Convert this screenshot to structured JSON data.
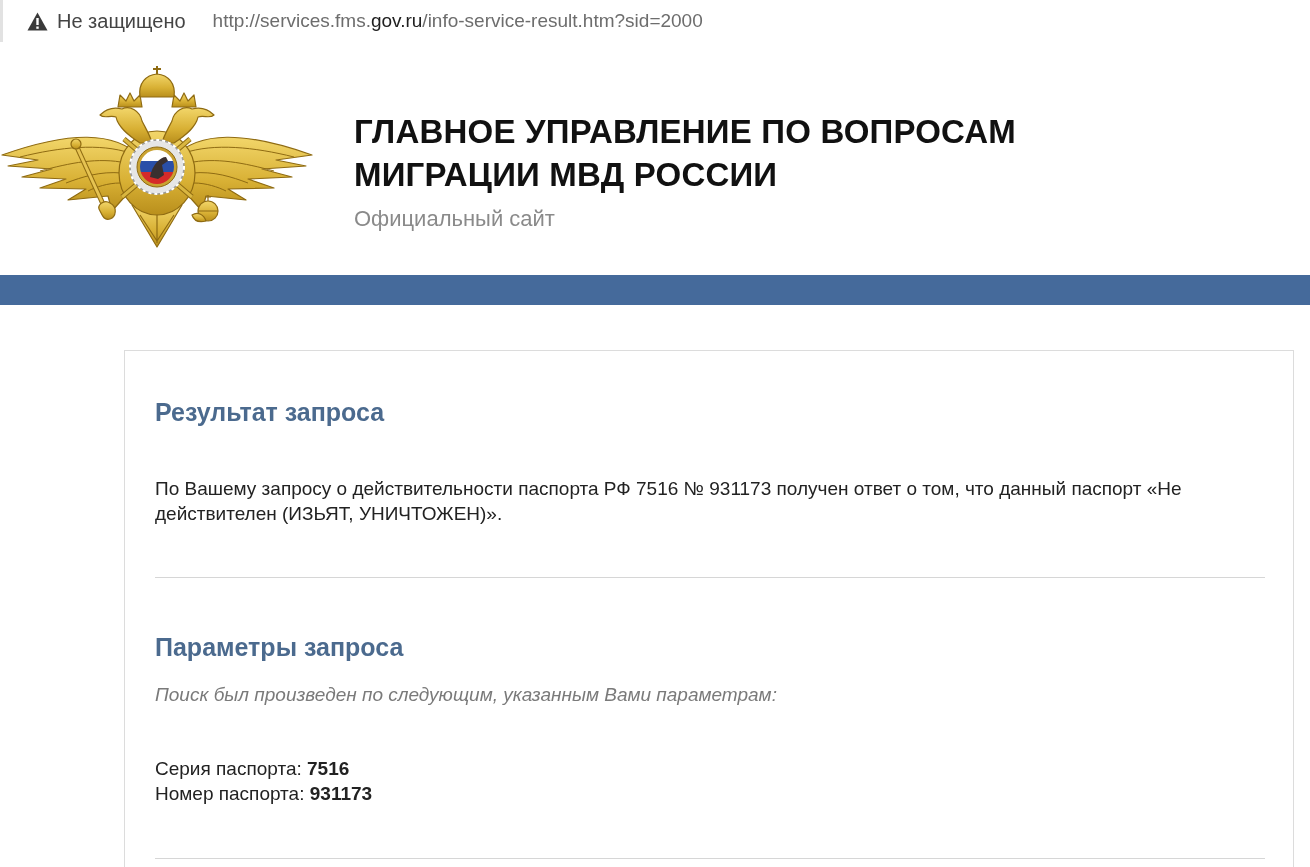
{
  "address_bar": {
    "security_label": "Не защищено",
    "url": {
      "host_prefix": "http://services.fms.",
      "domain": "gov.ru",
      "path": "/info-service-result.htm?sid=2000"
    }
  },
  "header": {
    "title": "ГЛАВНОЕ УПРАВЛЕНИЕ ПО ВОПРОСАМ МИГРАЦИИ МВД РОССИИ",
    "subtitle": "Официальный сайт"
  },
  "result": {
    "heading": "Результат запроса",
    "text": "По Вашему запросу о действительности паспорта РФ 7516 № 931173 получен ответ о том, что данный паспорт «Не действителен (ИЗЬЯТ, УНИЧТОЖЕН)»."
  },
  "parameters": {
    "heading": "Параметры запроса",
    "note": "Поиск был произведен по следующим, указанным Вами параметрам:",
    "lines": [
      "Серия паспорта: **7516**",
      "Номер паспорта: **931173**"
    ]
  }
}
